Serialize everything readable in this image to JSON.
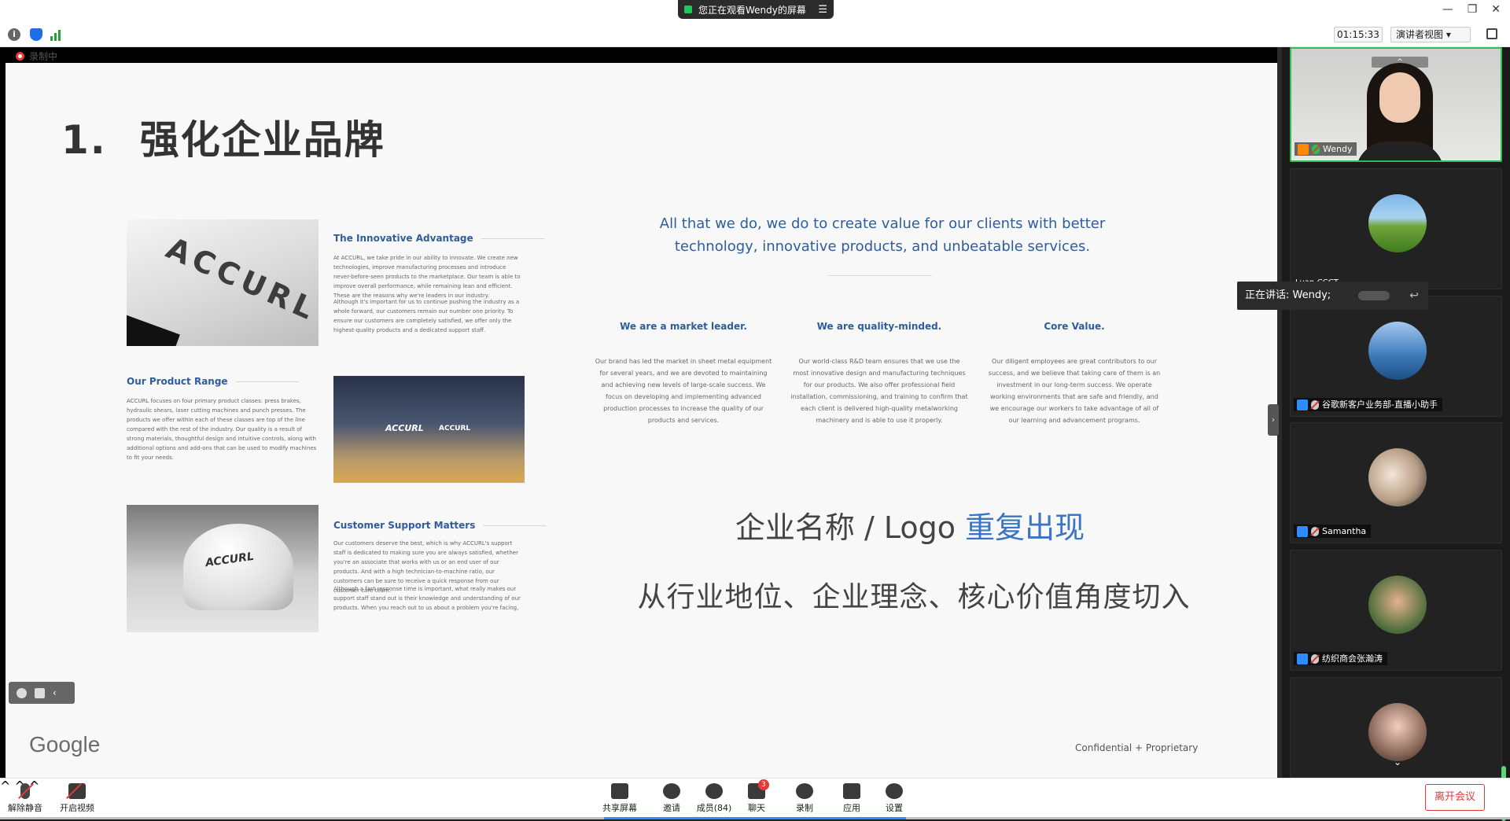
{
  "top_banner": {
    "sharing_text": "您正在观看Wendy的屏幕",
    "menu_icon": "menu-icon",
    "window_controls": [
      "—",
      "❐",
      "✕"
    ]
  },
  "infobar": {
    "icons": [
      "info-icon",
      "shield-icon",
      "signal-icon"
    ],
    "timer": "01:15:33",
    "view_mode": "演讲者视图 ▾"
  },
  "slide": {
    "title_number": "1.",
    "title": "强化企业品牌",
    "recording_label": "录制中",
    "images": {
      "accurl_logo": "ACCURL",
      "sky_logo_1": "ACCURL",
      "sky_logo_2": "ACCURL",
      "helmet_logo": "ACCURL"
    },
    "sections": [
      {
        "title": "The Innovative Advantage",
        "body": "At ACCURL, we take pride in our ability to innovate. We create new technologies, improve manufacturing processes and introduce never-before-seen products to the marketplace. Our team is able to improve overall performance, while remaining lean and efficient. These are the reasons why we're leaders in our industry.",
        "body2": "Although it's important for us to continue pushing the industry as a whole forward, our customers remain our number one priority. To ensure our customers are completely satisfied, we offer only the highest-quality products and a dedicated support staff."
      },
      {
        "title": "Our Product Range",
        "body": "ACCURL focuses on four primary product classes: press brakes, hydraulic shears, laser cutting machines and punch presses. The products we offer within each of these classes are top of the line compared with the rest of the industry. Our quality is a result of strong materials, thoughtful design and intuitive controls, along with additional options and add-ons that can be used to modify machines to fit your needs."
      },
      {
        "title": "Customer Support Matters",
        "body": "Our customers deserve the best, which is why ACCURL's support staff is dedicated to making sure you are always satisfied, whether you're an associate that works with us or an end user of our products. And with a high technician-to-machine ratio, our customers can be sure to receive a quick response from our customer care team.",
        "body2": "Although a fast response time is important, what really makes our support staff stand out is their knowledge and understanding of our products. When you reach out to us about a problem you're facing,"
      }
    ],
    "value_statement": "All that we do, we do to create value for our clients with better technology, innovative products, and unbeatable services.",
    "columns": [
      {
        "title": "We are a market leader.",
        "body": "Our brand has led the market in sheet metal equipment for several years, and we are devoted to maintaining and achieving new levels of large-scale success. We focus on developing and implementing advanced production processes to increase the quality of our products and services."
      },
      {
        "title": "We are quality-minded.",
        "body": "Our world-class R&D team ensures that we use the most innovative design and manufacturing techniques for our products. We also offer professional field installation, commissioning, and training to confirm that each client is delivered high-quality metalworking machinery and is able to use it properly."
      },
      {
        "title": "Core Value.",
        "body": "Our diligent employees are great contributors to our success, and we believe that taking care of them is an investment in our long-term success. We operate working environments that are safe and friendly, and we encourage our workers to take advantage of all of our learning and advancement programs."
      }
    ],
    "big_line1_plain": "企业名称 / Logo ",
    "big_line1_highlight": "重复出现",
    "big_line2": "从行业地位、企业理念、核心价值角度切入",
    "footer_logo": "Google",
    "footer_confidential": "Confidential + Proprietary",
    "annotation_icons": [
      "emoji-icon",
      "caption-icon",
      "collapse-icon"
    ],
    "annotation_collapse": "‹"
  },
  "panel": {
    "speaking_tip": "正在讲话: Wendy;",
    "speaking_back_icon": "↩",
    "handle": "›",
    "participants": [
      {
        "name": "Wendy",
        "chevron": "^"
      },
      {
        "name": "Luan-CCCT"
      },
      {
        "name": "谷歌新客户业务部-直播小助手"
      },
      {
        "name": "Samantha"
      },
      {
        "name": "纺织商会张瀚涛"
      },
      {
        "name": ""
      }
    ],
    "scroll_down": "⌄"
  },
  "controls": {
    "mute_label": "解除静音",
    "video_label": "开启视频",
    "share_label": "共享屏幕",
    "invite_label": "邀请",
    "members_label": "成员(84)",
    "chat_label": "聊天",
    "chat_badge": "3",
    "record_label": "录制",
    "apps_label": "应用",
    "settings_label": "设置",
    "leave_label": "离开会议",
    "caret": "^"
  },
  "colors": {
    "accent_blue": "#2f5d9c",
    "highlight_blue": "#3a74c4",
    "speaker_green": "#23c552",
    "leave_red": "#e53935"
  }
}
